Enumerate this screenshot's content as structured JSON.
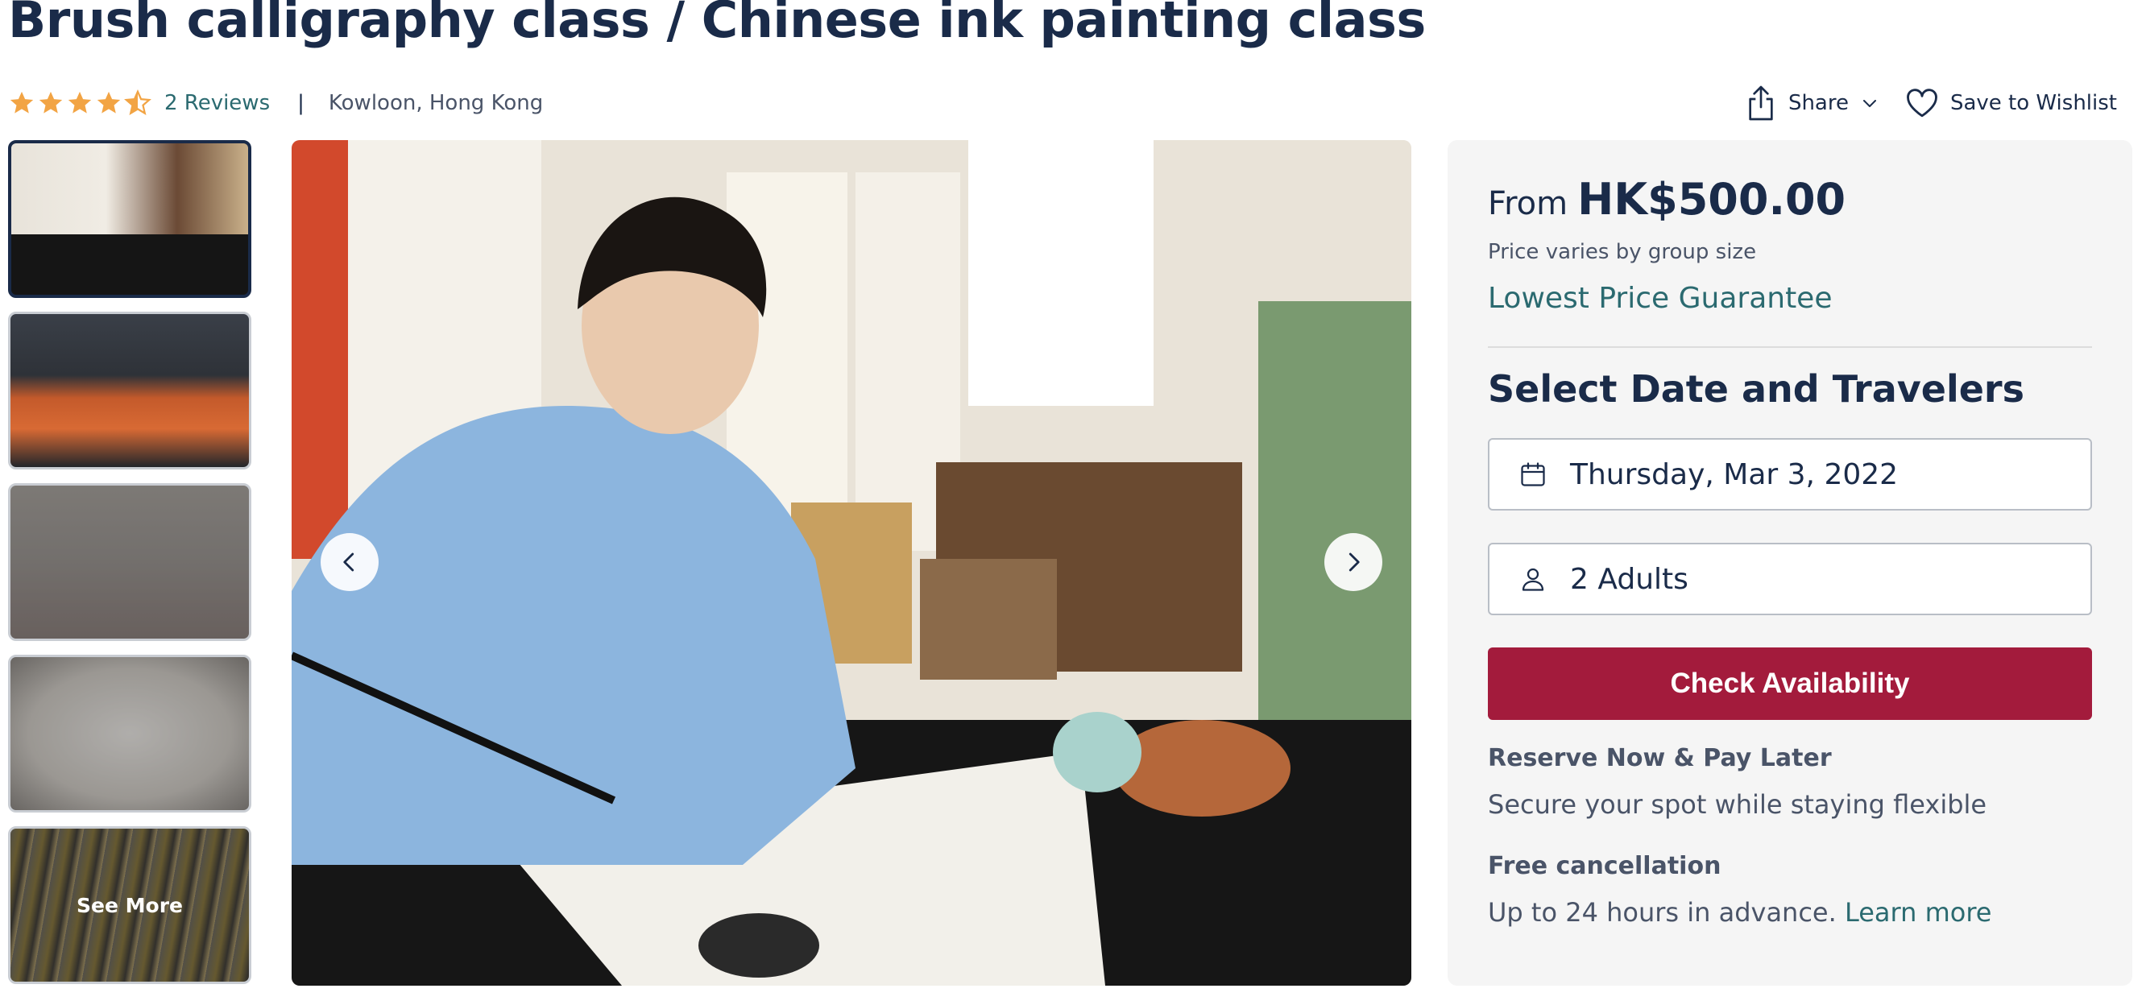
{
  "activity": {
    "title": "Brush calligraphy class / Chinese ink painting class",
    "rating": 4.5,
    "reviews_label": "2 Reviews",
    "separator": "|",
    "location": "Kowloon, Hong Kong"
  },
  "actions": {
    "share_label": "Share",
    "wishlist_label": "Save to Wishlist"
  },
  "gallery": {
    "thumbnails": [
      {
        "name": "thumb-1",
        "active": true
      },
      {
        "name": "thumb-2",
        "active": false
      },
      {
        "name": "thumb-3",
        "active": false
      },
      {
        "name": "thumb-4",
        "active": false
      },
      {
        "name": "thumb-5",
        "active": false
      }
    ],
    "see_more_label": "See More",
    "prev_icon": "chevron-left-icon",
    "next_icon": "chevron-right-icon"
  },
  "booking": {
    "from_label": "From",
    "price": "HK$500.00",
    "price_note": "Price varies by group size",
    "lowest_price": "Lowest Price Guarantee",
    "select_heading": "Select Date and Travelers",
    "date_value": "Thursday, Mar 3, 2022",
    "travelers_value": "2 Adults",
    "check_button": "Check Availability",
    "reserve_title": "Reserve Now & Pay Later",
    "reserve_text": "Secure your spot while staying flexible",
    "cancel_title": "Free cancellation",
    "cancel_text": "Up to 24 hours in advance.",
    "learn_more": "Learn more"
  },
  "colors": {
    "primary_text": "#1a2b49",
    "link_teal": "#2b6a70",
    "cta_red": "#a31b3c",
    "star_orange": "#f2a444",
    "panel_bg": "#f5f5f5"
  }
}
